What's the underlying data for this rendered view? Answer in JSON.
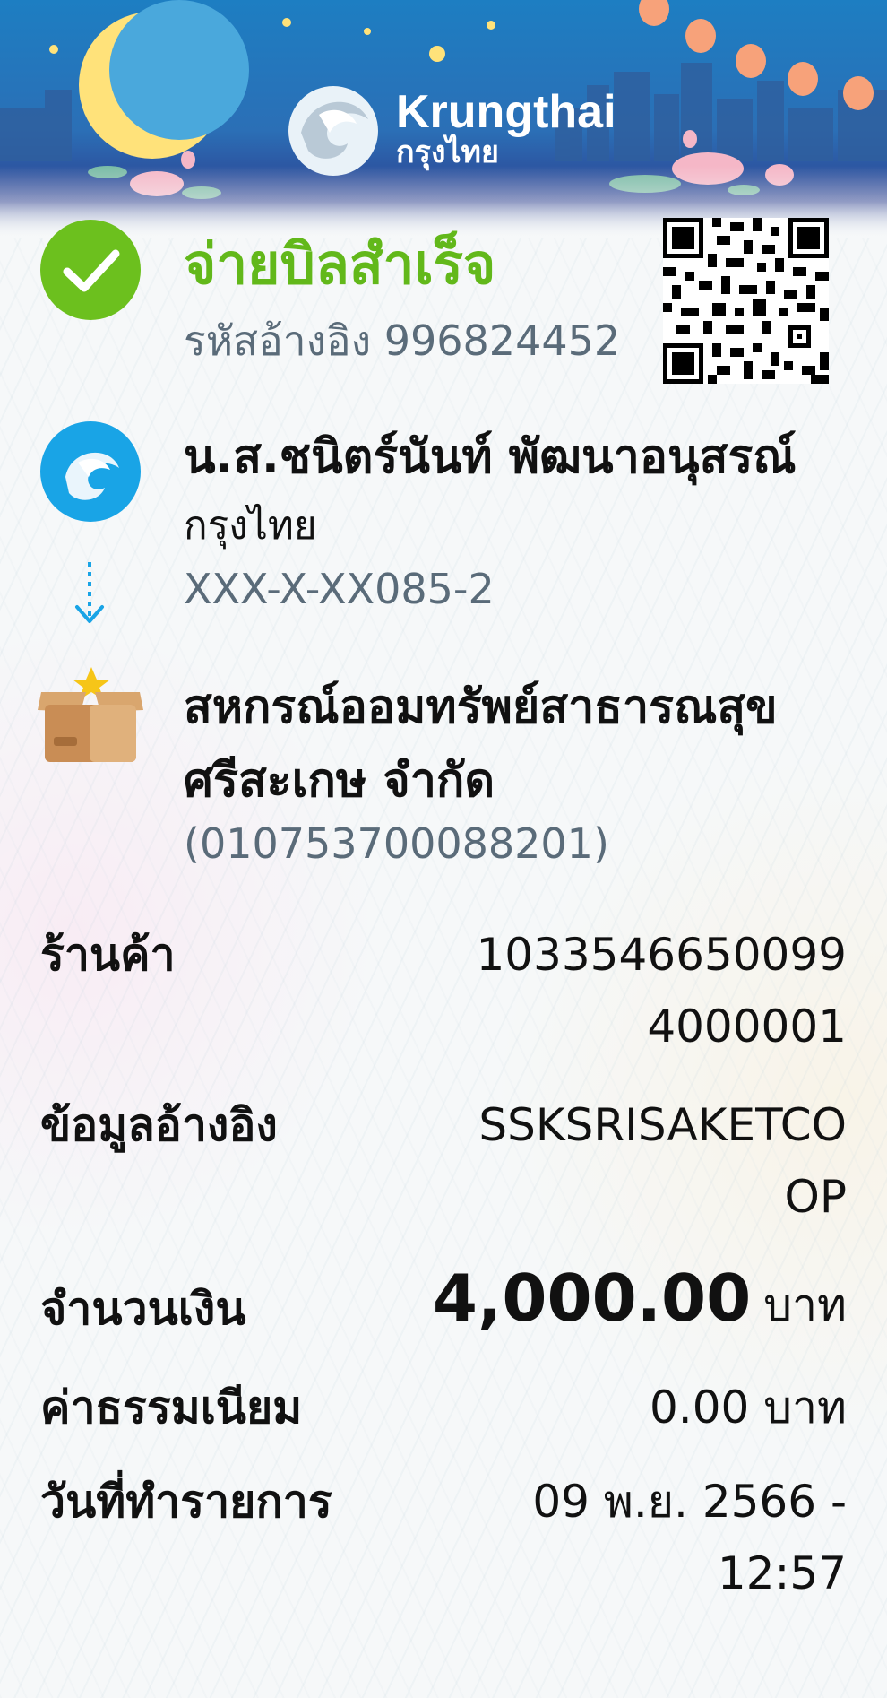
{
  "brand": {
    "name_en": "Krungthai",
    "name_th": "กรุงไทย"
  },
  "status": {
    "title": "จ่ายบิลสำเร็จ",
    "reference": "รหัสอ้างอิง 996824452"
  },
  "sender": {
    "name": "น.ส.ชนิตร์นันท์ พัฒนาอนุสรณ์",
    "bank": "กรุงไทย",
    "account": "XXX-X-XX085-2"
  },
  "recipient": {
    "name": "สหกรณ์ออมทรัพย์สาธารณสุขศรีสะเกษ จำกัด",
    "biller_id": "(010753700088201)"
  },
  "details": {
    "merchant_label": "ร้านค้า",
    "merchant_value": "10335466500994000001",
    "ref_label": "ข้อมูลอ้างอิง",
    "ref_value": "SSKSRISAKETCOOP",
    "amount_label": "จำนวนเงิน",
    "amount_value": "4,000.00",
    "amount_unit": "บาท",
    "fee_label": "ค่าธรรมเนียม",
    "fee_value": "0.00 บาท",
    "date_label": "วันที่ทำรายการ",
    "date_value": "09 พ.ย. 2566 - 12:57"
  },
  "colors": {
    "success": "#62b81a",
    "brand_blue": "#19a4e6",
    "muted": "#5a6b79"
  }
}
